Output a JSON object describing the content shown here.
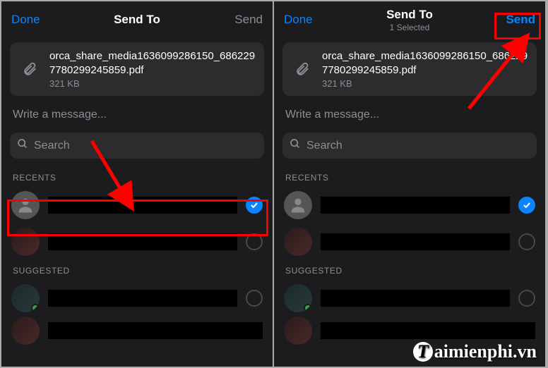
{
  "left": {
    "header": {
      "done": "Done",
      "title": "Send To",
      "send": "Send"
    },
    "attachment": {
      "name": "orca_share_media1636099286150_6862297780299245859.pdf",
      "size": "321 KB"
    },
    "message_placeholder": "Write a message...",
    "search_placeholder": "Search",
    "sections": {
      "recents": "RECENTS",
      "suggested": "SUGGESTED"
    }
  },
  "right": {
    "header": {
      "done": "Done",
      "title": "Send To",
      "subtitle": "1 Selected",
      "send": "Send"
    },
    "attachment": {
      "name": "orca_share_media1636099286150_6862297780299245859.pdf",
      "size": "321 KB"
    },
    "message_placeholder": "Write a message...",
    "search_placeholder": "Search",
    "sections": {
      "recents": "RECENTS",
      "suggested": "SUGGESTED"
    }
  },
  "watermark": "aimienphi.vn"
}
